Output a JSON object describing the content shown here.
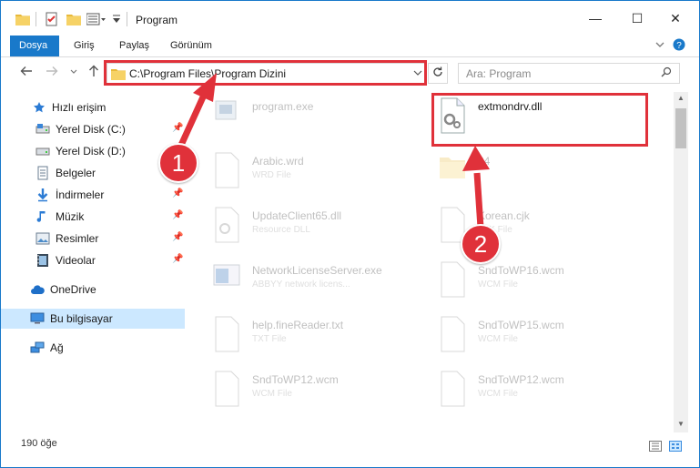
{
  "window": {
    "title": "Program",
    "controls": {
      "minimize": "—",
      "maximize": "☐",
      "close": "✕"
    }
  },
  "ribbon": {
    "tabs": [
      {
        "label": "Dosya",
        "active": true
      },
      {
        "label": "Giriş",
        "active": false
      },
      {
        "label": "Paylaş",
        "active": false
      },
      {
        "label": "Görünüm",
        "active": false
      }
    ],
    "expand_icon": "chevron-down-icon",
    "help_icon": "help-icon"
  },
  "address": {
    "path": "C:\\Program Files\\Program Dizini",
    "search_placeholder": "Ara: Program"
  },
  "sidebar": {
    "items": [
      {
        "label": "Hızlı erişim",
        "icon": "star-icon"
      },
      {
        "label": "Yerel Disk (C:)",
        "icon": "drive-icon"
      },
      {
        "label": "Yerel Disk (D:)",
        "icon": "drive-icon"
      },
      {
        "label": "Belgeler",
        "icon": "documents-icon"
      },
      {
        "label": "İndirmeler",
        "icon": "download-icon"
      },
      {
        "label": "Müzik",
        "icon": "music-icon"
      },
      {
        "label": "Resimler",
        "icon": "pictures-icon"
      },
      {
        "label": "Videolar",
        "icon": "video-icon"
      },
      {
        "label": "OneDrive",
        "icon": "cloud-icon"
      },
      {
        "label": "Bu bilgisayar",
        "icon": "computer-icon"
      },
      {
        "label": "Ağ",
        "icon": "network-icon"
      }
    ]
  },
  "files": [
    {
      "name": "program.exe",
      "type": ""
    },
    {
      "name": "extmondrv.dll",
      "type": ""
    },
    {
      "name": "Arabic.wrd",
      "type": "WRD File"
    },
    {
      "name": "64",
      "type": ""
    },
    {
      "name": "UpdateClient65.dll",
      "type": "Resource DLL"
    },
    {
      "name": "Korean.cjk",
      "type": "CJK File"
    },
    {
      "name": "NetworkLicenseServer.exe",
      "type": "ABBYY network licens..."
    },
    {
      "name": "SndToWP16.wcm",
      "type": "WCM File"
    },
    {
      "name": "help.fineReader.txt",
      "type": "TXT File"
    },
    {
      "name": "SndToWP15.wcm",
      "type": "WCM File"
    },
    {
      "name": "SndToWP12.wcm",
      "type": "WCM File"
    },
    {
      "name": "SndToWP12.wcm",
      "type": "WCM File"
    }
  ],
  "status": {
    "count": "190 öğe"
  },
  "callouts": {
    "one": "1",
    "two": "2"
  },
  "colors": {
    "accent": "#1979ca",
    "highlight": "#e0313a",
    "selected": "#cce8ff"
  }
}
